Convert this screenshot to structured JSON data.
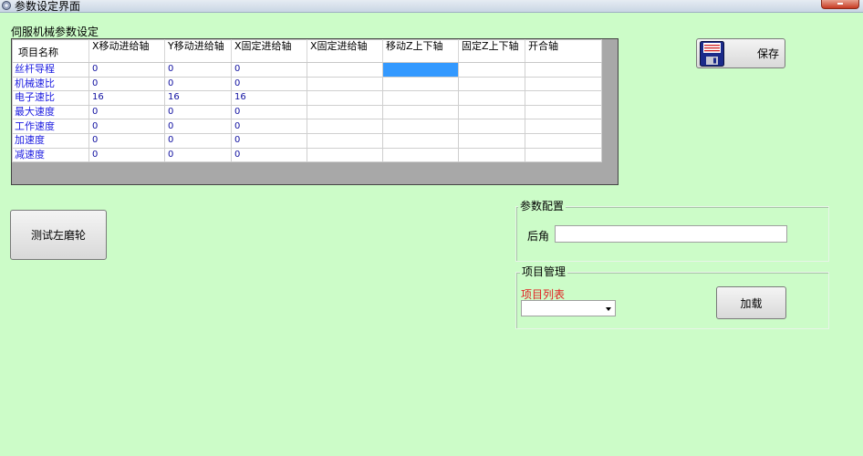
{
  "window": {
    "title": "参数设定界面",
    "icon": "app-gear-icon"
  },
  "servo_group": {
    "label": "伺服机械参数设定",
    "columns": [
      "项目名称",
      "X移动进给轴",
      "Y移动进给轴",
      "X固定进给轴",
      "X固定进给轴",
      "移动Z上下轴",
      "固定Z上下轴",
      "开合轴"
    ],
    "rows": [
      {
        "name": "丝杆导程",
        "values": [
          "0",
          "0",
          "0",
          "",
          "",
          "",
          ""
        ]
      },
      {
        "name": "机械速比",
        "values": [
          "0",
          "0",
          "0",
          "",
          "",
          "",
          ""
        ]
      },
      {
        "name": "电子速比",
        "values": [
          "16",
          "16",
          "16",
          "",
          "",
          "",
          ""
        ]
      },
      {
        "name": "最大速度",
        "values": [
          "0",
          "0",
          "0",
          "",
          "",
          "",
          ""
        ]
      },
      {
        "name": "工作速度",
        "values": [
          "0",
          "0",
          "0",
          "",
          "",
          "",
          ""
        ]
      },
      {
        "name": "加速度",
        "values": [
          "0",
          "0",
          "0",
          "",
          "",
          "",
          ""
        ]
      },
      {
        "name": "减速度",
        "values": [
          "0",
          "0",
          "0",
          "",
          "",
          "",
          ""
        ]
      }
    ],
    "selected_cell": {
      "row": 0,
      "col": 4
    }
  },
  "buttons": {
    "save": "保存",
    "test_left_grinder": "测试左磨轮",
    "load": "加载"
  },
  "param_config": {
    "legend": "参数配置",
    "back_angle_label": "后角",
    "back_angle_value": ""
  },
  "project_mgmt": {
    "legend": "项目管理",
    "list_label": "项目列表",
    "selected": ""
  },
  "colors": {
    "background": "#ccfcc8",
    "cell_text": "#1010a0",
    "row_header_text": "#1a1ae0",
    "selection": "#3399ff",
    "red_label": "#e02020"
  }
}
